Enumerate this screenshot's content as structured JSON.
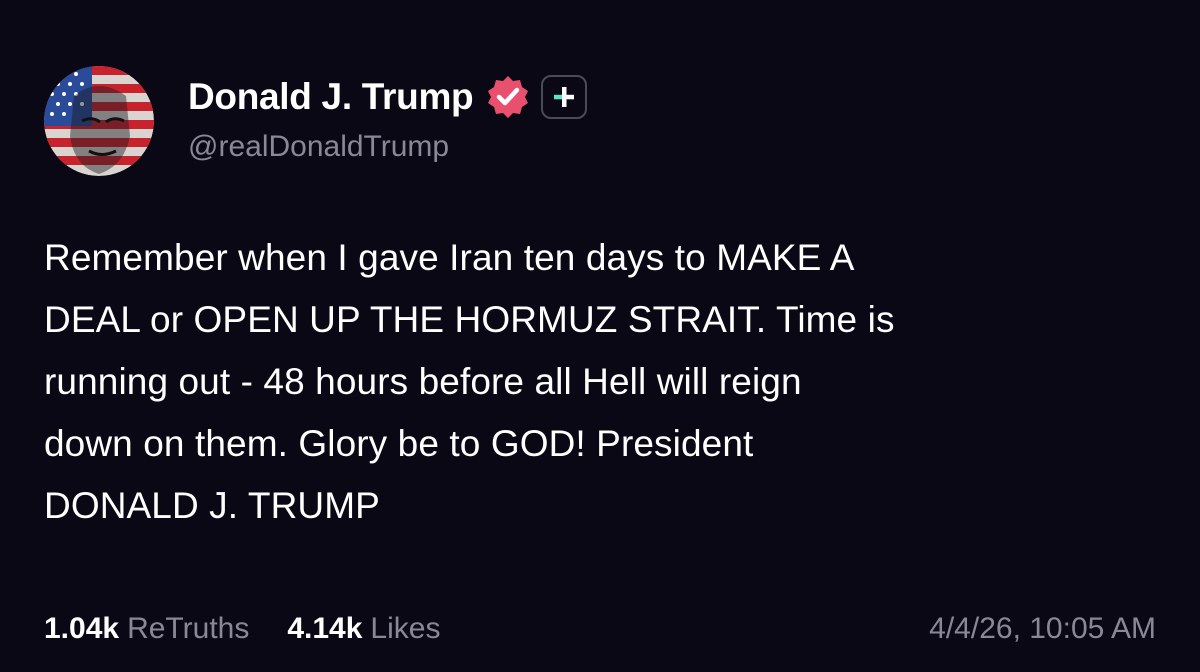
{
  "author": {
    "display_name": "Donald J. Trump",
    "handle": "@realDonaldTrump",
    "verified": true
  },
  "post": {
    "lines": [
      "Remember when I gave Iran ten days to MAKE A",
      "DEAL or OPEN UP THE HORMUZ STRAIT. Time is",
      "running out - 48 hours before all Hell will reign",
      "down on them. Glory be to GOD! President",
      "DONALD J. TRUMP"
    ],
    "timestamp": "4/4/26, 10:05 AM"
  },
  "stats": {
    "retruths_count": "1.04k",
    "retruths_label": "ReTruths",
    "likes_count": "4.14k",
    "likes_label": "Likes"
  },
  "colors": {
    "background": "#0b0816",
    "primary_text": "#ffffff",
    "secondary_text": "#8a8796",
    "verified_badge": "#e8506e",
    "plus_accent": "#5fe0c8"
  },
  "icons": {
    "verified": "verified-badge-icon",
    "plus": "plus-badge-icon"
  }
}
